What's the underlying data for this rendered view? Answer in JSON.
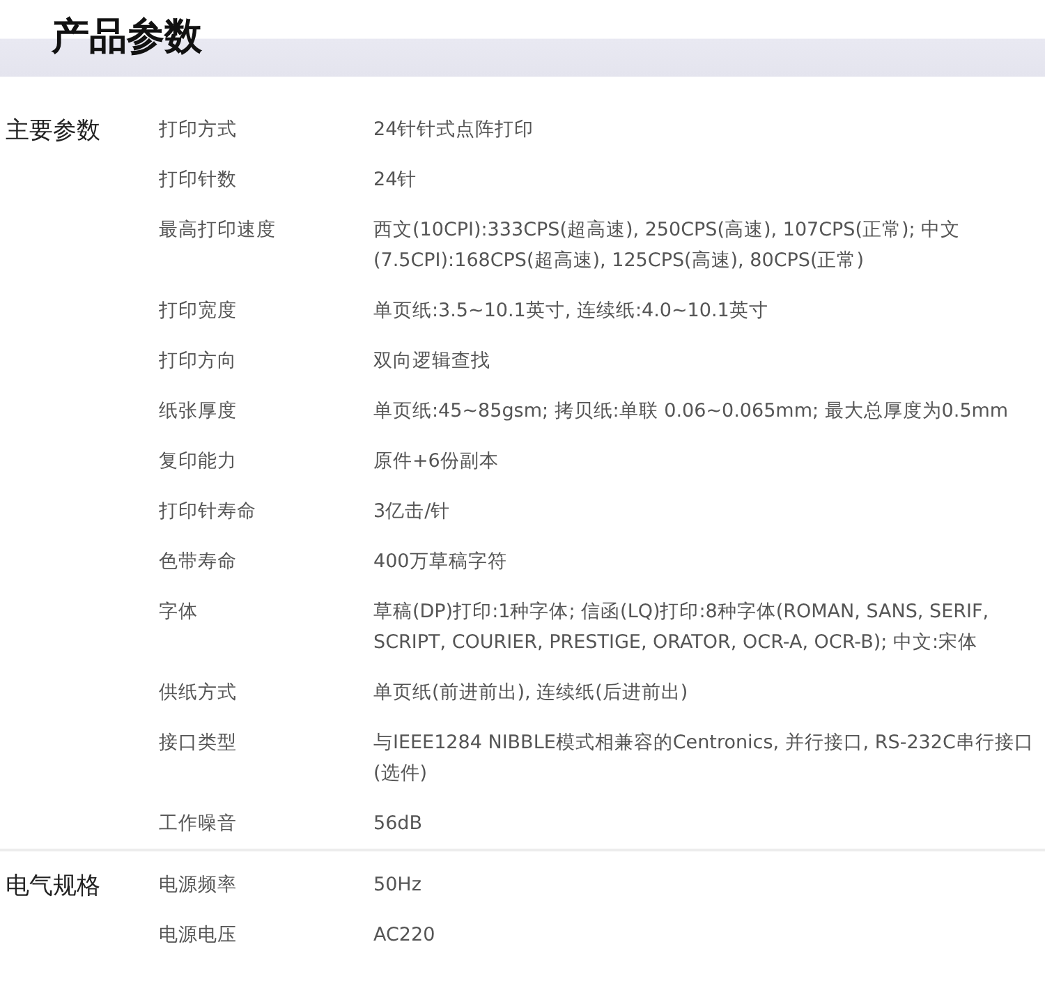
{
  "title": "产品参数",
  "sections": [
    {
      "name": "主要参数",
      "rows": [
        {
          "key": "打印方式",
          "value": "24针针式点阵打印"
        },
        {
          "key": "打印针数",
          "value": "24针"
        },
        {
          "key": "最高打印速度",
          "value": "西文(10CPI):333CPS(超高速), 250CPS(高速), 107CPS(正常); 中文(7.5CPI):168CPS(超高速), 125CPS(高速), 80CPS(正常)"
        },
        {
          "key": "打印宽度",
          "value": "单页纸:3.5~10.1英寸, 连续纸:4.0~10.1英寸"
        },
        {
          "key": "打印方向",
          "value": "双向逻辑查找"
        },
        {
          "key": "纸张厚度",
          "value": "单页纸:45~85gsm; 拷贝纸:单联 0.06~0.065mm; 最大总厚度为0.5mm"
        },
        {
          "key": "复印能力",
          "value": "原件+6份副本"
        },
        {
          "key": "打印针寿命",
          "value": "3亿击/针"
        },
        {
          "key": "色带寿命",
          "value": "400万草稿字符"
        },
        {
          "key": "字体",
          "value": "草稿(DP)打印:1种字体; 信函(LQ)打印:8种字体(ROMAN, SANS, SERIF, SCRIPT, COURIER, PRESTIGE, ORATOR, OCR-A, OCR-B); 中文:宋体"
        },
        {
          "key": "供纸方式",
          "value": "单页纸(前进前出), 连续纸(后进前出)"
        },
        {
          "key": "接口类型",
          "value": "与IEEE1284 NIBBLE模式相兼容的Centronics, 并行接口, RS-232C串行接口(选件)"
        },
        {
          "key": "工作噪音",
          "value": "56dB"
        }
      ]
    },
    {
      "name": "电气规格",
      "rows": [
        {
          "key": "电源频率",
          "value": "50Hz"
        },
        {
          "key": "电源电压",
          "value": "AC220"
        }
      ]
    }
  ]
}
